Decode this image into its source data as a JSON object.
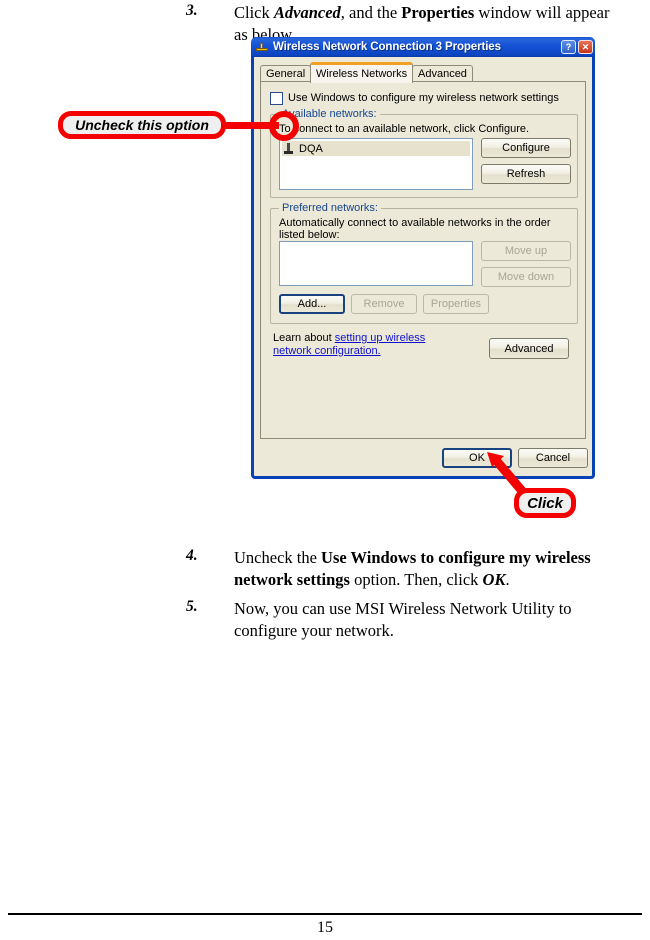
{
  "document": {
    "steps": [
      {
        "number": "3.",
        "text_parts": [
          {
            "t": "Click ",
            "style": "normal"
          },
          {
            "t": "Advanced",
            "style": "bolditalic"
          },
          {
            "t": ", and the ",
            "style": "normal"
          },
          {
            "t": "Properties",
            "style": "bold"
          },
          {
            "t": " window will appear as below.",
            "style": "normal"
          }
        ]
      },
      {
        "number": "4.",
        "text_parts": [
          {
            "t": "Uncheck the ",
            "style": "normal"
          },
          {
            "t": "Use Windows to configure my wireless network settings",
            "style": "bold"
          },
          {
            "t": " option.  Then, click ",
            "style": "normal"
          },
          {
            "t": "OK",
            "style": "bolditalic"
          },
          {
            "t": ".",
            "style": "normal"
          }
        ]
      },
      {
        "number": "5.",
        "text_parts": [
          {
            "t": "Now, you can use MSI Wireless Network Utility to configure your network.",
            "style": "normal"
          }
        ]
      }
    ],
    "page_number": "15"
  },
  "dialog": {
    "title": "Wireless Network Connection 3 Properties",
    "title_icon": "network-adapter-icon",
    "titlebar_buttons": [
      {
        "name": "help-button",
        "glyph": "?"
      },
      {
        "name": "close-button",
        "glyph": "✕"
      }
    ],
    "tabs": [
      {
        "label": "General",
        "active": false
      },
      {
        "label": "Wireless Networks",
        "active": true
      },
      {
        "label": "Advanced",
        "active": false
      }
    ],
    "use_windows_checkbox": {
      "label": "Use Windows to configure my wireless network settings",
      "checked": false
    },
    "available_networks": {
      "group_title": "Available networks:",
      "description": "To connect to an available network, click Configure.",
      "items": [
        {
          "name": "DQA",
          "icon": "wireless-network-icon",
          "selected": true
        }
      ],
      "buttons": [
        {
          "label": "Configure",
          "enabled": true
        },
        {
          "label": "Refresh",
          "enabled": true
        }
      ]
    },
    "preferred_networks": {
      "group_title": "Preferred networks:",
      "description": "Automatically connect to available networks in the order listed below:",
      "items": [],
      "side_buttons": [
        {
          "label": "Move up",
          "enabled": false
        },
        {
          "label": "Move down",
          "enabled": false
        }
      ],
      "bottom_buttons": [
        {
          "label": "Add...",
          "enabled": true,
          "default": true
        },
        {
          "label": "Remove",
          "enabled": false
        },
        {
          "label": "Properties",
          "enabled": false
        }
      ]
    },
    "learn_more": {
      "prefix": "Learn about ",
      "link": "setting up wireless network configuration.",
      "button": "Advanced"
    },
    "footer_buttons": [
      {
        "label": "OK",
        "default": true
      },
      {
        "label": "Cancel",
        "default": false
      }
    ]
  },
  "annotations": {
    "uncheck_callout": "Uncheck this option",
    "click_callout": "Click",
    "accent_color": "#f40000"
  }
}
